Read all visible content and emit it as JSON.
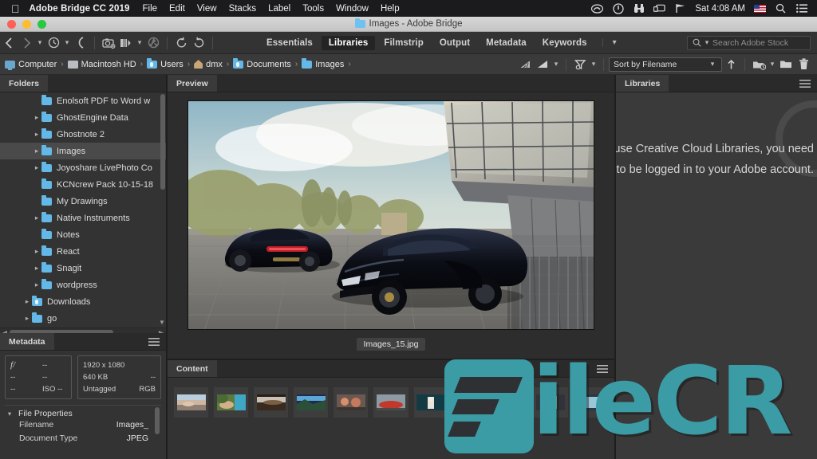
{
  "menubar": {
    "apple_icon": "apple-logo",
    "app_name": "Adobe Bridge CC 2019",
    "items": [
      "File",
      "Edit",
      "View",
      "Stacks",
      "Label",
      "Tools",
      "Window",
      "Help"
    ],
    "status_icons": [
      "creative-cloud-icon",
      "power-icon",
      "binoculars-icon",
      "screen-sharing-icon",
      "flag-icon"
    ],
    "clock": "Sat 4:08 AM",
    "input_flag": "us-flag-icon",
    "spotlight_icon": "search-icon",
    "control_center_icon": "list-icon"
  },
  "window": {
    "title": "Images - Adobe Bridge",
    "title_folder_icon": "folder-icon"
  },
  "toolbar": {
    "back_icon": "chevron-left-icon",
    "forward_icon": "chevron-right-icon",
    "dropdown_icon": "chevron-down-icon",
    "recent_icon": "clock-icon",
    "recent_dropdown_icon": "chevron-down-icon",
    "boomerang_icon": "return-icon",
    "camera_icon": "get-photos-from-camera-icon",
    "copy_icon": "refine-icon",
    "copy_dropdown_icon": "chevron-down-icon",
    "aperture_icon": "open-in-camera-raw-icon",
    "rotate_ccw_icon": "rotate-counterclockwise-icon",
    "rotate_cw_icon": "rotate-clockwise-icon",
    "workspaces": [
      {
        "label": "Essentials",
        "active": false
      },
      {
        "label": "Libraries",
        "active": true
      },
      {
        "label": "Filmstrip",
        "active": false
      },
      {
        "label": "Output",
        "active": false
      },
      {
        "label": "Metadata",
        "active": false
      },
      {
        "label": "Keywords",
        "active": false
      }
    ],
    "workspace_more_icon": "chevron-down-icon",
    "search": {
      "icon": "search-icon",
      "dropdown_icon": "chevron-down-icon",
      "placeholder": "Search Adobe Stock",
      "value": ""
    }
  },
  "pathbar": {
    "crumbs": [
      {
        "label": "Computer",
        "icon": "computer-icon"
      },
      {
        "label": "Macintosh HD",
        "icon": "harddisk-icon"
      },
      {
        "label": "Users",
        "icon": "users-folder-icon"
      },
      {
        "label": "dmx",
        "icon": "home-folder-icon"
      },
      {
        "label": "Documents",
        "icon": "documents-folder-icon"
      },
      {
        "label": "Images",
        "icon": "folder-icon"
      }
    ],
    "separator": "›",
    "tools": {
      "filter_rating_icon": "filter-by-rating-icon",
      "filter_rating_dropdown_icon": "chevron-down-icon",
      "filter_items_icon": "filter-items-icon",
      "filter_items_dropdown_icon": "chevron-down-icon",
      "sort_label": "Sort by Filename",
      "sort_dropdown_icon": "chevron-down-icon",
      "sort_direction_icon": "arrow-up-icon",
      "new_folder_icon": "new-folder-icon",
      "new_folder_dropdown_icon": "chevron-down-icon",
      "create_folder_icon": "folder-icon",
      "delete_icon": "trash-icon"
    }
  },
  "folders_panel": {
    "tab_label": "Folders",
    "items": [
      {
        "label": "Enolsoft PDF to Word w",
        "indent": 2,
        "expandable": false,
        "selected": false
      },
      {
        "label": "GhostEngine Data",
        "indent": 2,
        "expandable": true,
        "selected": false
      },
      {
        "label": "Ghostnote 2",
        "indent": 2,
        "expandable": true,
        "selected": false
      },
      {
        "label": "Images",
        "indent": 2,
        "expandable": true,
        "selected": true
      },
      {
        "label": "Joyoshare LivePhoto Co",
        "indent": 2,
        "expandable": true,
        "selected": false
      },
      {
        "label": "KCNcrew Pack 10-15-18",
        "indent": 2,
        "expandable": false,
        "selected": false
      },
      {
        "label": "My Drawings",
        "indent": 2,
        "expandable": false,
        "selected": false
      },
      {
        "label": "Native Instruments",
        "indent": 2,
        "expandable": true,
        "selected": false
      },
      {
        "label": "Notes",
        "indent": 2,
        "expandable": false,
        "selected": false
      },
      {
        "label": "React",
        "indent": 2,
        "expandable": true,
        "selected": false
      },
      {
        "label": "Snagit",
        "indent": 2,
        "expandable": true,
        "selected": false
      },
      {
        "label": "wordpress",
        "indent": 2,
        "expandable": true,
        "selected": false
      },
      {
        "label": "Downloads",
        "indent": 1,
        "expandable": true,
        "selected": false
      },
      {
        "label": "go",
        "indent": 1,
        "expandable": true,
        "selected": false
      }
    ],
    "expand_icon": "chevron-right-icon",
    "scroll_up_icon": "chevron-up-icon",
    "scroll_down_icon": "chevron-down-icon",
    "hscroll_left_icon": "chevron-left-icon",
    "hscroll_right_icon": "chevron-right-icon"
  },
  "metadata_panel": {
    "tab_label": "Metadata",
    "burger_icon": "hamburger-menu-icon",
    "camera_box": [
      {
        "a": "f/",
        "b": "--",
        "c": "--"
      },
      {
        "a": "--",
        "b": "--",
        "c": ""
      },
      {
        "a": "--",
        "b": "ISO --",
        "c": ""
      }
    ],
    "file_box": [
      {
        "b": "1920 x 1080",
        "c": ""
      },
      {
        "b": "640 KB",
        "c": "--"
      },
      {
        "b": "Untagged",
        "c": "RGB"
      }
    ],
    "section_title": "File Properties",
    "section_disclosure_icon": "chevron-down-icon",
    "properties": [
      {
        "label": "Filename",
        "value": "Images_"
      },
      {
        "label": "Document Type",
        "value": "JPEG"
      }
    ]
  },
  "preview_panel": {
    "tab_label": "Preview",
    "image_alt": "two black sports cars parked in front of modern glass building",
    "filename": "Images_15.jpg"
  },
  "content_panel": {
    "tab_label": "Content",
    "burger_icon": "hamburger-menu-icon",
    "thumbnails": [
      {
        "name": "thumb-1"
      },
      {
        "name": "thumb-2"
      },
      {
        "name": "thumb-3"
      },
      {
        "name": "thumb-4"
      },
      {
        "name": "thumb-5"
      },
      {
        "name": "thumb-6"
      },
      {
        "name": "thumb-7"
      },
      {
        "name": "thumb-8"
      },
      {
        "name": "thumb-9"
      },
      {
        "name": "thumb-10"
      },
      {
        "name": "thumb-11"
      }
    ]
  },
  "libraries_panel": {
    "tab_label": "Libraries",
    "burger_icon": "hamburger-menu-icon",
    "message": "To use Creative Cloud Libraries, you need to be logged in to your Adobe account."
  },
  "watermark": {
    "text": "ileCR",
    "color": "#3b9ca6"
  }
}
